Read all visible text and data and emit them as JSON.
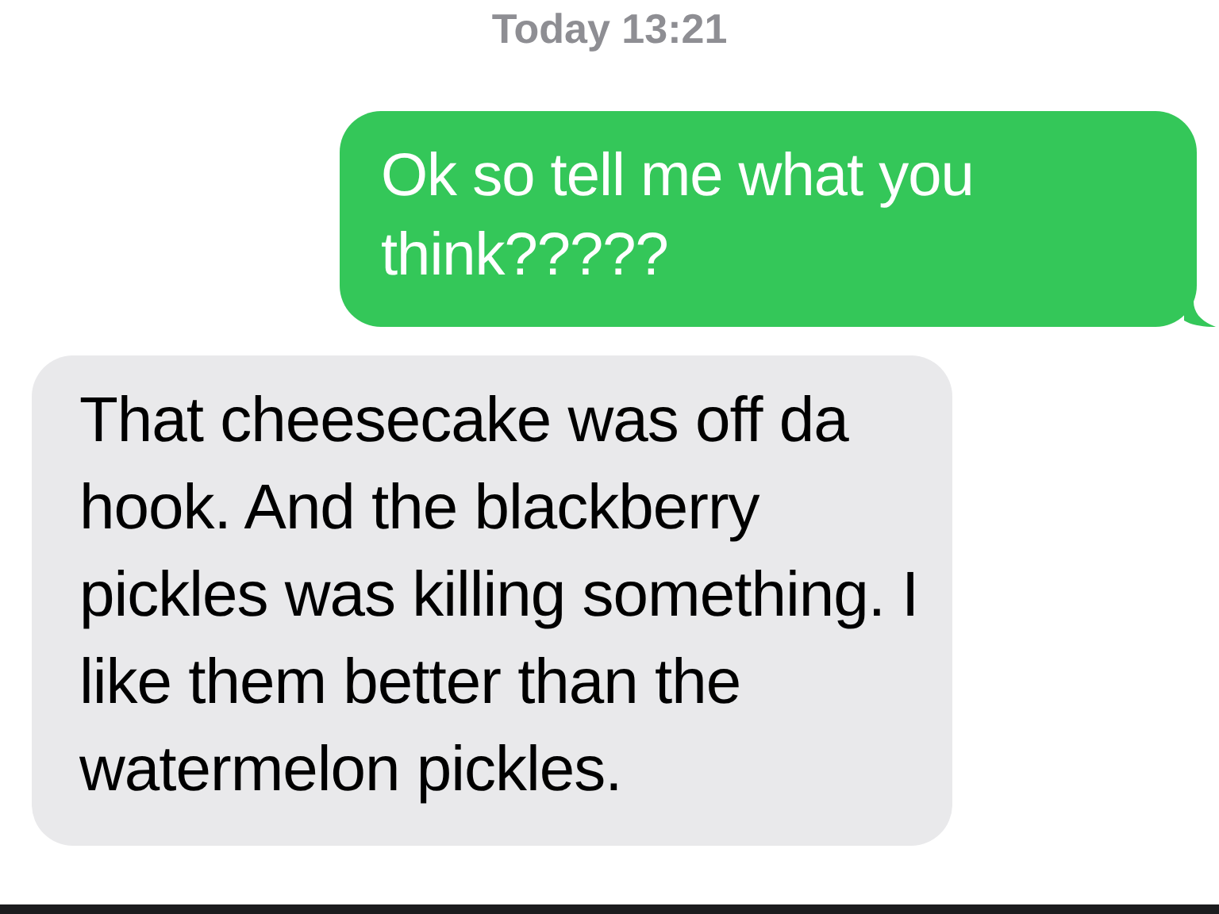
{
  "timestamp": "Today 13:21",
  "messages": [
    {
      "kind": "sent",
      "text": "Ok so tell me what you think?????"
    },
    {
      "kind": "received",
      "text": "That cheesecake was off da hook. And the blackberry pickles was killing something. I like them better than the watermelon pickles."
    }
  ]
}
